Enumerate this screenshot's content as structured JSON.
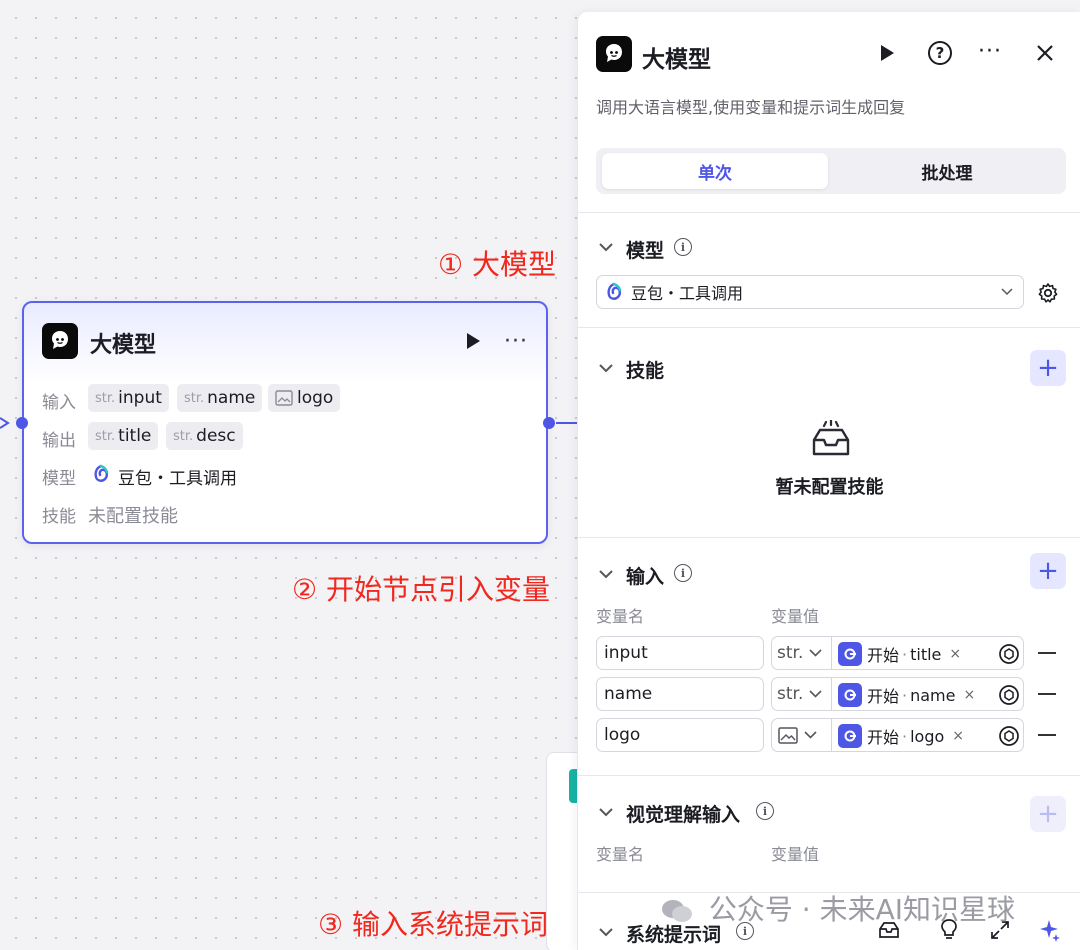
{
  "node": {
    "title": "大模型",
    "input_label": "输入",
    "output_label": "输出",
    "model_label": "模型",
    "skills_label": "技能",
    "inputs": [
      {
        "type": "str.",
        "name": "input"
      },
      {
        "type": "str.",
        "name": "name"
      },
      {
        "type": "image",
        "name": "logo"
      }
    ],
    "outputs": [
      {
        "type": "str.",
        "name": "title"
      },
      {
        "type": "str.",
        "name": "desc"
      }
    ],
    "model_value": "豆包・工具调用",
    "skills_value": "未配置技能"
  },
  "annotations": {
    "a1": "① 大模型",
    "a2": "② 开始节点引入变量",
    "a3": "③ 输入系统提示词"
  },
  "panel": {
    "title": "大模型",
    "description": "调用大语言模型,使用变量和提示词生成回复",
    "tabs": [
      "单次",
      "批处理"
    ],
    "active_tab": "单次",
    "model_section": {
      "title": "模型",
      "selected": "豆包・工具调用"
    },
    "skills_section": {
      "title": "技能",
      "empty_text": "暂未配置技能"
    },
    "input_section": {
      "title": "输入",
      "col_name": "变量名",
      "col_value": "变量值",
      "rows": [
        {
          "name": "input",
          "type": "str.",
          "ref_source": "开始",
          "ref_field": "title"
        },
        {
          "name": "name",
          "type": "str.",
          "ref_source": "开始",
          "ref_field": "name"
        },
        {
          "name": "logo",
          "type": "image",
          "ref_source": "开始",
          "ref_field": "logo"
        }
      ]
    },
    "vision_section": {
      "title": "视觉理解输入",
      "col_name": "变量名",
      "col_value": "变量值"
    },
    "system_prompt_section": {
      "title": "系统提示词"
    }
  },
  "watermark": "公众号 · 未来AI知识星球",
  "colors": {
    "accent": "#4e56e6",
    "annotation": "#f0281e",
    "node_border": "#5b62f0"
  }
}
